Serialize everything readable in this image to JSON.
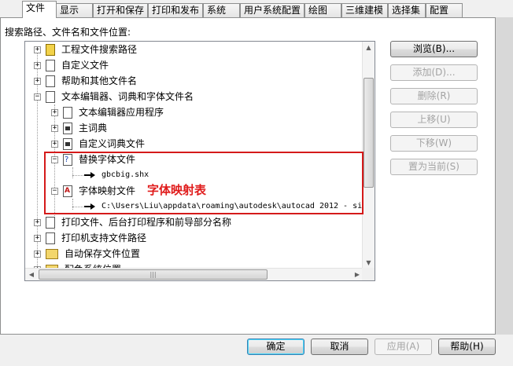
{
  "tabs": [
    "文件",
    "显示",
    "打开和保存",
    "打印和发布",
    "系统",
    "用户系统配置",
    "绘图",
    "三维建模",
    "选择集",
    "配置"
  ],
  "tree_caption": "搜索路径、文件名和文件位置:",
  "tree": {
    "items": [
      {
        "expander": "+",
        "icon": "project-file-icon",
        "label": "工程文件搜索路径"
      },
      {
        "expander": "+",
        "icon": "document-icon",
        "label": "自定义文件"
      },
      {
        "expander": "+",
        "icon": "document-icon",
        "label": "帮助和其他文件名"
      },
      {
        "expander": "−",
        "icon": "documents-icon",
        "label": "文本编辑器、词典和字体文件名"
      },
      {
        "expander": "+",
        "icon": "text-editor-icon",
        "label": "文本编辑器应用程序"
      },
      {
        "expander": "+",
        "icon": "dictionary-icon",
        "label": "主词典"
      },
      {
        "expander": "+",
        "icon": "dictionary-icon",
        "label": "自定义词典文件"
      },
      {
        "expander": "−",
        "icon": "font-file-icon",
        "label": "替换字体文件"
      },
      {
        "expander": "",
        "icon": "arrow-icon",
        "label": "gbcbig.shx"
      },
      {
        "expander": "−",
        "icon": "font-map-icon",
        "label": "字体映射文件"
      },
      {
        "expander": "",
        "icon": "arrow-icon",
        "label": "C:\\Users\\Liu\\appdata\\roaming\\autodesk\\autocad 2012 - si"
      },
      {
        "expander": "+",
        "icon": "document-icon",
        "label": "打印文件、后台打印程序和前导部分名称"
      },
      {
        "expander": "+",
        "icon": "document-icon",
        "label": "打印机支持文件路径"
      },
      {
        "expander": "+",
        "icon": "folder-icon",
        "label": "自动保存文件位置"
      },
      {
        "expander": "+",
        "icon": "folder-icon",
        "label": "配色系统位置"
      }
    ]
  },
  "annotation": "字体映射表",
  "side_buttons": {
    "browse": "浏览(B)...",
    "add": "添加(D)...",
    "delete": "删除(R)",
    "move_up": "上移(U)",
    "move_down": "下移(W)",
    "set_current": "置为当前(S)"
  },
  "footer_buttons": {
    "ok": "确定",
    "cancel": "取消",
    "apply": "应用(A)",
    "help": "帮助(H)"
  },
  "colors": {
    "annotation": "#e01b1b",
    "highlight_border": "#d51a1a"
  }
}
